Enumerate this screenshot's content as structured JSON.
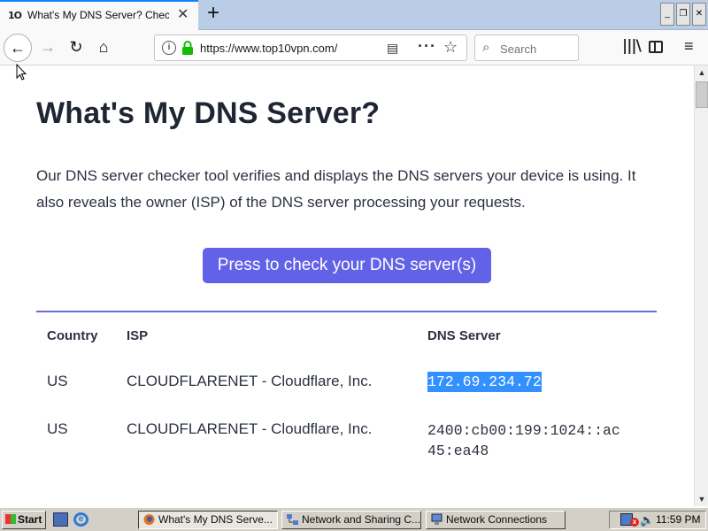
{
  "tab": {
    "favicon": "1O",
    "title": "What's My DNS Server? Check Y",
    "close": "✕"
  },
  "newtab": "+",
  "window_controls": {
    "minimize": "_",
    "restore": "❐",
    "close": "✕"
  },
  "nav": {
    "back": "←",
    "forward": "→",
    "reload": "↻",
    "home": "⌂",
    "url": "https://www.top10vpn.com/",
    "more": "···",
    "bookmark_star": "☆",
    "search_placeholder": "Search",
    "library": "|||\\",
    "menu": "≡"
  },
  "page": {
    "title": "What's My DNS Server?",
    "description": "Our DNS server checker tool verifies and displays the DNS servers your device is using. It also reveals the owner (ISP) of the DNS server processing your requests.",
    "check_button": "Press to check your DNS server(s)",
    "table": {
      "headers": [
        "Country",
        "ISP",
        "DNS Server"
      ],
      "rows": [
        {
          "country": "US",
          "isp": "CLOUDFLARENET - Cloudflare, Inc.",
          "dns": "172.69.234.72",
          "selected": true
        },
        {
          "country": "US",
          "isp": "CLOUDFLARENET - Cloudflare, Inc.",
          "dns": "2400:cb00:199:1024::ac45:ea48",
          "dns_line1": "2400:cb00:199:1024::ac",
          "dns_line2": "45:ea48",
          "selected": false
        }
      ]
    }
  },
  "scrollbar": {
    "up": "▲",
    "down": "▼"
  },
  "taskbar": {
    "start": "Start",
    "tasks": [
      {
        "label": "What's My DNS Serve...",
        "active": true
      },
      {
        "label": "Network and Sharing C...",
        "active": false
      },
      {
        "label": "Network Connections",
        "active": false
      }
    ],
    "tray_error": "x",
    "volume": "🔈",
    "clock": "11:59 PM"
  },
  "colors": {
    "accent_tab": "#0a84ff",
    "button_bg": "#6262e8",
    "table_rule": "#6b6bd6",
    "selection": "#3390ff"
  }
}
